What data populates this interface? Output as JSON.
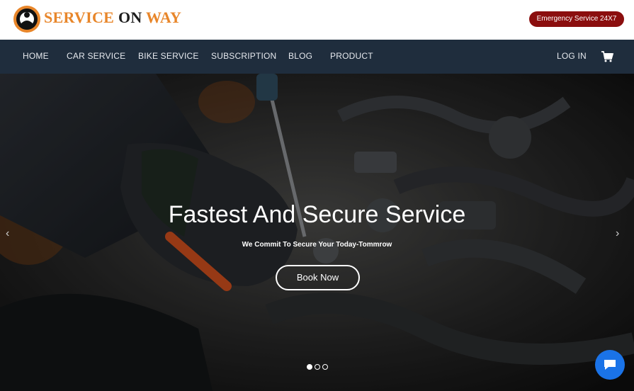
{
  "brand": {
    "word1": "SERVICE",
    "word2": "ON",
    "word3": "WAY",
    "emergency_label": "Emergency Service 24X7"
  },
  "nav": {
    "items": [
      "HOME",
      "CAR SERVICE",
      "BIKE SERVICE",
      "SUBSCRIPTION",
      "BLOG",
      "PRODUCT"
    ],
    "login": "LOG IN",
    "cart_icon": "cart-icon"
  },
  "hero": {
    "title": "Fastest And Secure Service",
    "subtitle": "We Commit To Secure Your Today-Tommrow",
    "cta": "Book Now",
    "prev": "‹",
    "next": "›",
    "slide_count": 3,
    "active_slide": 1
  },
  "chat": {
    "icon": "chat-bubble-icon"
  },
  "colors": {
    "accent": "#e8862a",
    "nav_bg": "#1f2d3d",
    "emergency_bg": "#8b0e0e",
    "chat_bg": "#1a73e8"
  }
}
